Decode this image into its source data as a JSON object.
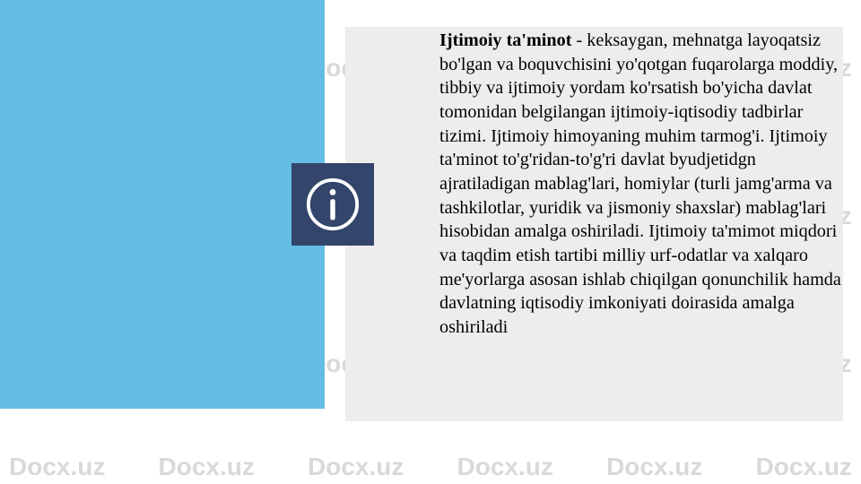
{
  "watermark": "Docx.uz",
  "icon": {
    "name": "info-icon"
  },
  "content": {
    "heading": "Ijtimoiy ta'minot",
    "paragraph_rest": " - keksaygan, mehnatga layoqatsiz bo'lgan va boquvchisini yo'qotgan fuqarolarga moddiy, tibbiy va ijtimoiy yordam ko'rsatish bo'yicha davlat tomonidan belgilangan ijtimoiy-iqtisodiy tadbirlar tizimi. Ijtimoiy himoyaning muhim tarmog'i. Ijtimoiy ta'minot to'g'ridan-to'g'ri davlat byudjetidgn ajratiladigan mablag'lari, homiylar (turli jamg'arma va tashkilotlar, yuridik va jismoniy shaxslar) mablag'lari hisobidan amalga oshiriladi. Ijtimoiy ta'mimot miqdori va taqdim etish tartibi milliy urf-odatlar va xalqaro me'yorlarga asosan ishlab chiqilgan qonunchilik hamda davlatning iqtisodiy imkoniyati doirasida amalga oshiriladi"
  }
}
